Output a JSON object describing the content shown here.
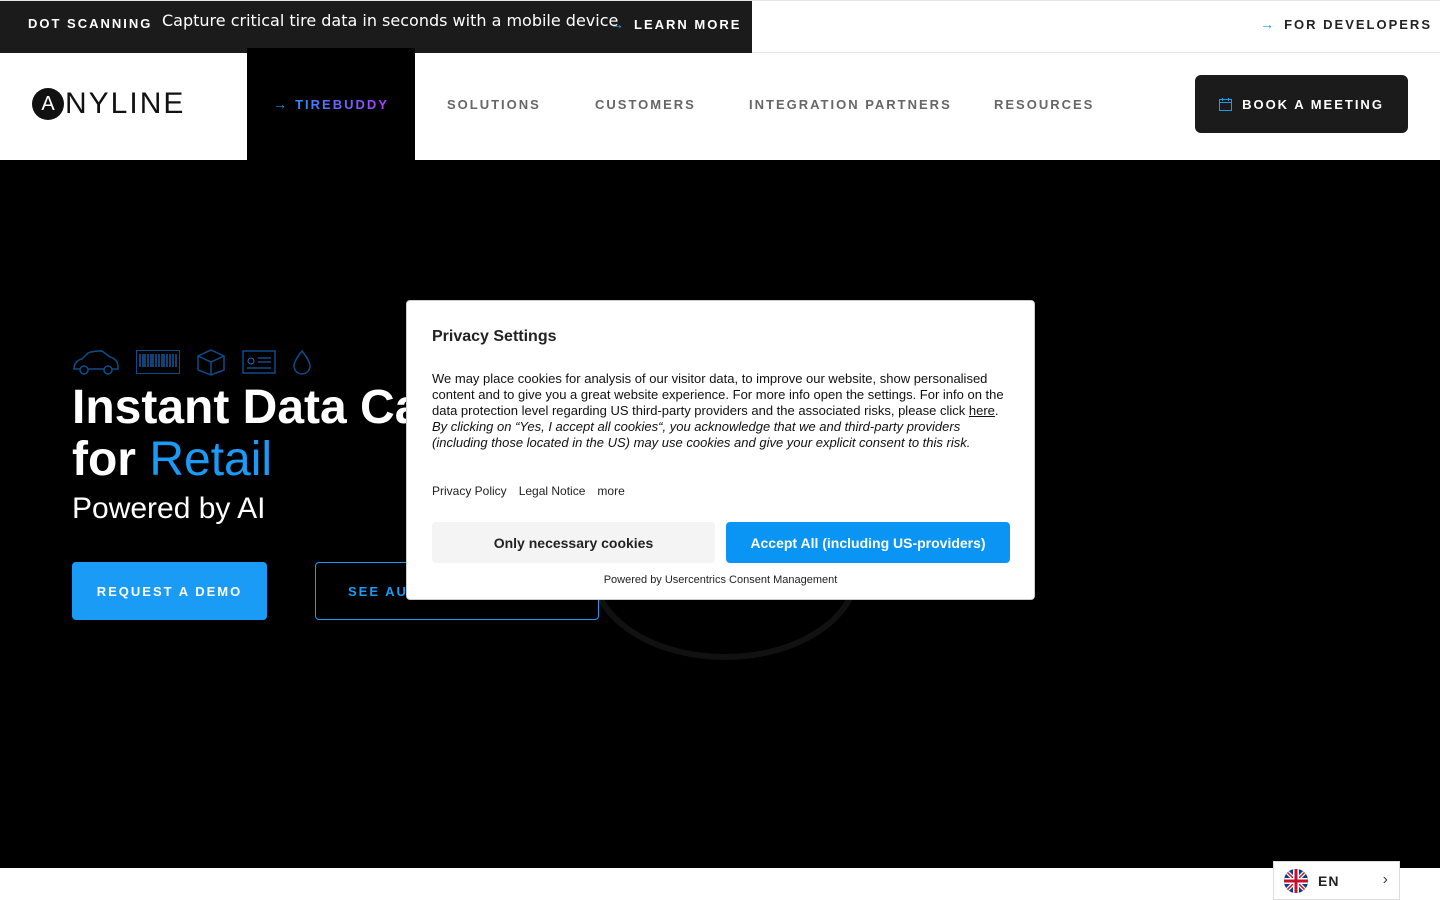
{
  "announcement": {
    "tag": "DOT SCANNING",
    "message": "Capture critical tire data in seconds with a mobile device",
    "link_label": "LEARN MORE"
  },
  "top_right_link": "FOR DEVELOPERS",
  "nav": {
    "logo_mark": "A",
    "logo_text": "NYLINE",
    "active_item": "TIREBUDDY",
    "items": [
      "SOLUTIONS",
      "CUSTOMERS",
      "INTEGRATION PARTNERS",
      "RESOURCES"
    ],
    "cta_label": "BOOK A MEETING"
  },
  "hero": {
    "headline_line1": "Instant Data Ca",
    "headline_line2_prefix": "for",
    "headline_accent": "Retail",
    "subheadline": "Powered by AI",
    "primary_button": "REQUEST A DEMO",
    "secondary_button": "SEE AUT",
    "category_icons": [
      "car-icon",
      "barcode-icon",
      "box-icon",
      "id-card-icon",
      "drop-icon"
    ]
  },
  "privacy_modal": {
    "title": "Privacy Settings",
    "body_text": "We may place cookies for analysis of our visitor data, to improve our website, show personalised content and to give you a great website experience. For more info open the settings. For info on the data protection level regarding US third-party providers and the associated risks, please click ",
    "body_link": "here",
    "body_period": ".",
    "consent_text": "By clicking on “Yes, I accept all cookies“, you acknowledge that we and third-party providers (including those located in the US) may use cookies and give your explicit consent to this risk.",
    "links": [
      "Privacy Policy",
      "Legal Notice",
      "more"
    ],
    "necessary_button": "Only necessary cookies",
    "accept_button": "Accept All (including US-providers)",
    "powered_by": "Powered by Usercentrics Consent Management"
  },
  "language": {
    "code": "EN",
    "flag": "uk-flag-icon"
  },
  "colors": {
    "accent": "#1a9bf5",
    "dark": "#1b1b1b",
    "hero_bg": "#000000"
  }
}
